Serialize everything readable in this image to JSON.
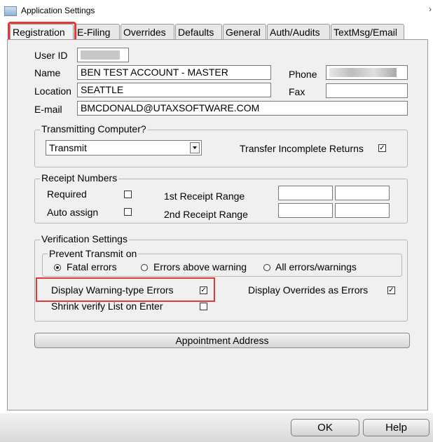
{
  "window": {
    "title": "Application Settings",
    "edge_glyph": "›"
  },
  "tabs": [
    {
      "label": "Registration",
      "active": true
    },
    {
      "label": "E-Filing",
      "active": false
    },
    {
      "label": "Overrides",
      "active": false
    },
    {
      "label": "Defaults",
      "active": false
    },
    {
      "label": "General",
      "active": false
    },
    {
      "label": "Auth/Audits",
      "active": false
    },
    {
      "label": "TextMsg/Email",
      "active": false
    }
  ],
  "registration": {
    "user_id_label": "User ID",
    "name_label": "Name",
    "name_value": "BEN TEST ACCOUNT - MASTER",
    "phone_label": "Phone",
    "location_label": "Location",
    "location_value": "SEATTLE",
    "fax_label": "Fax",
    "fax_value": "",
    "email_label": "E-mail",
    "email_value": "BMCDONALD@UTAXSOFTWARE.COM"
  },
  "transmitting": {
    "legend": "Transmitting Computer?",
    "selected": "Transmit",
    "transfer_label": "Transfer Incomplete Returns",
    "transfer_checked": true
  },
  "receipt": {
    "legend": "Receipt Numbers",
    "required_label": "Required",
    "required_checked": false,
    "auto_label": "Auto assign",
    "auto_checked": false,
    "range1_label": "1st Receipt Range",
    "range2_label": "2nd Receipt Range"
  },
  "verification": {
    "legend": "Verification Settings",
    "prevent_legend": "Prevent Transmit on",
    "options": [
      "Fatal errors",
      "Errors above warning",
      "All errors/warnings"
    ],
    "selected_option": "Fatal errors",
    "display_warning_label": "Display Warning-type Errors",
    "display_warning_checked": true,
    "display_overrides_label": "Display Overrides as Errors",
    "display_overrides_checked": true,
    "shrink_label": "Shrink verify List on Enter",
    "shrink_checked": false
  },
  "appointment_button": "Appointment Address",
  "footer": {
    "ok": "OK",
    "help": "Help"
  },
  "colors": {
    "highlight": "#e53935",
    "panel": "#f0f0f0"
  },
  "checkmark_glyph": "✓"
}
